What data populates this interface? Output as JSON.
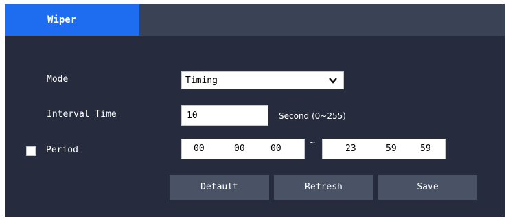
{
  "tabs": [
    {
      "label": "Wiper",
      "active": true
    }
  ],
  "form": {
    "mode_label": "Mode",
    "mode_value": "Timing",
    "interval_label": "Interval Time",
    "interval_value": "10",
    "interval_unit": "Second (0~255)",
    "period_label": "Period",
    "period_checked": false,
    "period_start": {
      "h": "00",
      "m": "00",
      "s": "00"
    },
    "period_separator": "~",
    "period_end": {
      "h": "23",
      "m": "59",
      "s": "59"
    }
  },
  "buttons": {
    "default": "Default",
    "refresh": "Refresh",
    "save": "Save"
  },
  "colors": {
    "panel": "#262c3e",
    "tab_active": "#1e6cf0",
    "tabbar": "#3a4256",
    "button": "#4a5266"
  }
}
